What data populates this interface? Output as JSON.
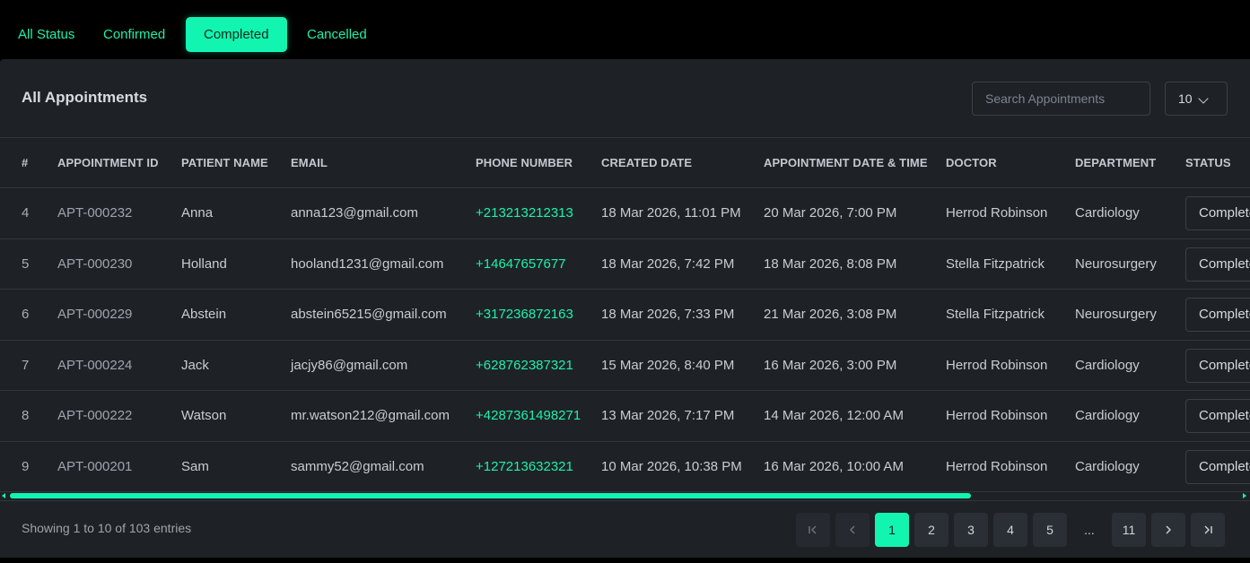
{
  "filters": [
    "All Status",
    "Confirmed",
    "Completed",
    "Cancelled"
  ],
  "active_filter": "Completed",
  "panel": {
    "title": "All Appointments",
    "search_placeholder": "Search Appointments",
    "page_size": "10"
  },
  "table": {
    "columns": [
      "#",
      "APPOINTMENT ID",
      "PATIENT NAME",
      "EMAIL",
      "PHONE NUMBER",
      "CREATED DATE",
      "APPOINTMENT DATE & TIME",
      "DOCTOR",
      "DEPARTMENT",
      "STATUS"
    ],
    "rows": [
      {
        "num": "4",
        "id": "APT-000232",
        "name": "Anna",
        "email": "anna123@gmail.com",
        "phone": "+213213212313",
        "created": "18 Mar 2026, 11:01 PM",
        "appt": "20 Mar 2026, 7:00 PM",
        "doctor": "Herrod Robinson",
        "dept": "Cardiology",
        "status": "Completed"
      },
      {
        "num": "5",
        "id": "APT-000230",
        "name": "Holland",
        "email": "hooland1231@gmail.com",
        "phone": "+14647657677",
        "created": "18 Mar 2026, 7:42 PM",
        "appt": "18 Mar 2026, 8:08 PM",
        "doctor": "Stella Fitzpatrick",
        "dept": "Neurosurgery",
        "status": "Completed"
      },
      {
        "num": "6",
        "id": "APT-000229",
        "name": "Abstein",
        "email": "abstein65215@gmail.com",
        "phone": "+317236872163",
        "created": "18 Mar 2026, 7:33 PM",
        "appt": "21 Mar 2026, 3:08 PM",
        "doctor": "Stella Fitzpatrick",
        "dept": "Neurosurgery",
        "status": "Completed"
      },
      {
        "num": "7",
        "id": "APT-000224",
        "name": "Jack",
        "email": "jacjy86@gmail.com",
        "phone": "+628762387321",
        "created": "15 Mar 2026, 8:40 PM",
        "appt": "16 Mar 2026, 3:00 PM",
        "doctor": "Herrod Robinson",
        "dept": "Cardiology",
        "status": "Completed"
      },
      {
        "num": "8",
        "id": "APT-000222",
        "name": "Watson",
        "email": "mr.watson212@gmail.com",
        "phone": "+4287361498271",
        "created": "13 Mar 2026, 7:17 PM",
        "appt": "14 Mar 2026, 12:00 AM",
        "doctor": "Herrod Robinson",
        "dept": "Cardiology",
        "status": "Completed"
      },
      {
        "num": "9",
        "id": "APT-000201",
        "name": "Sam",
        "email": "sammy52@gmail.com",
        "phone": "+127213632321",
        "created": "10 Mar 2026, 10:38 PM",
        "appt": "16 Mar 2026, 10:00 AM",
        "doctor": "Herrod Robinson",
        "dept": "Cardiology",
        "status": "Completed"
      }
    ]
  },
  "footer": {
    "showing": "Showing 1 to 10 of 103 entries",
    "pages": [
      "1",
      "2",
      "3",
      "4",
      "5",
      "...",
      "11"
    ],
    "current_page": "1",
    "first_icon": "first-page-icon",
    "prev_icon": "chevron-left-icon",
    "next_icon": "chevron-right-icon",
    "last_icon": "last-page-icon"
  },
  "colors": {
    "accent": "#12f5b0",
    "panel": "#1e2227",
    "background": "#000000"
  }
}
